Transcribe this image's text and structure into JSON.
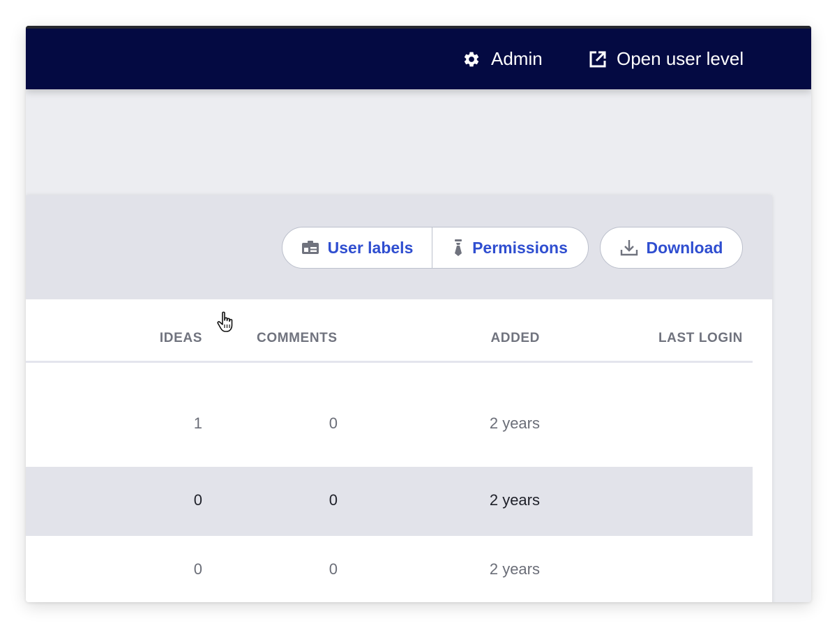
{
  "topbar": {
    "admin": {
      "label": "Admin",
      "icon": "gear-icon"
    },
    "open_user_level": {
      "label": "Open user level",
      "icon": "external-link-icon"
    }
  },
  "toolbar": {
    "user_labels": {
      "label": "User labels",
      "icon": "id-card-icon"
    },
    "permissions": {
      "label": "Permissions",
      "icon": "tie-icon"
    },
    "download": {
      "label": "Download",
      "icon": "download-icon"
    }
  },
  "table": {
    "columns": {
      "ideas": "IDEAS",
      "comments": "COMMENTS",
      "added": "ADDED",
      "last_login": "LAST LOGIN"
    },
    "rows": [
      {
        "ideas": "1",
        "comments": "0",
        "added": "2 years",
        "last_login": "",
        "hovered": false
      },
      {
        "ideas": "0",
        "comments": "0",
        "added": "2 years",
        "last_login": "",
        "hovered": true
      },
      {
        "ideas": "0",
        "comments": "0",
        "added": "2 years",
        "last_login": "",
        "hovered": false
      }
    ]
  },
  "colors": {
    "topbar_bg": "#040a42",
    "accent": "#2f4ed0",
    "page_bg": "#ecedf1",
    "hover_row": "#e2e3ea"
  }
}
